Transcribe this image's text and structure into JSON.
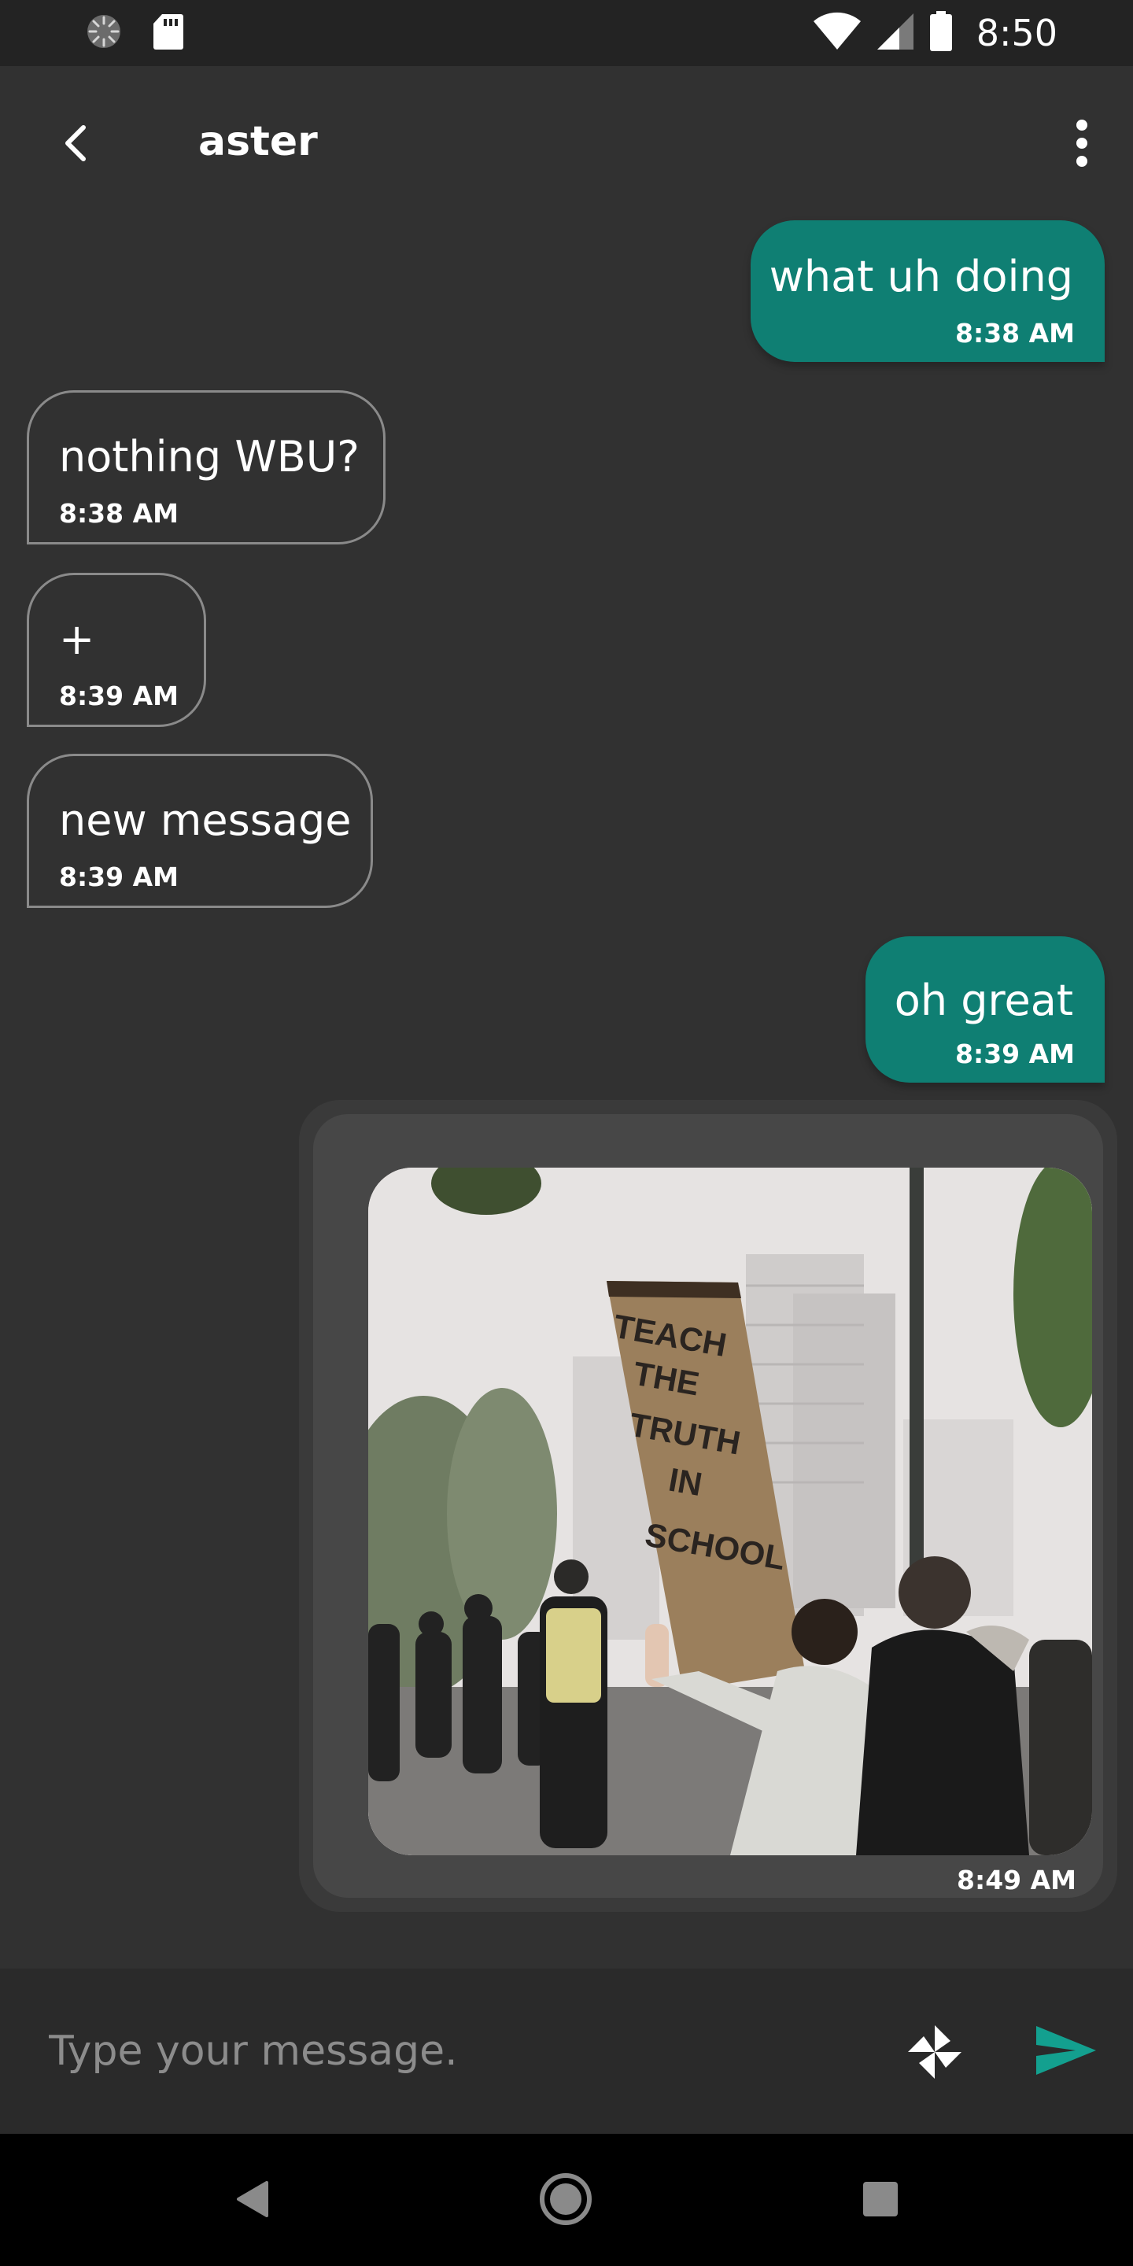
{
  "status_bar": {
    "time": "8:50",
    "icons": [
      "sync-icon",
      "sd-card-icon",
      "wifi-icon",
      "cell-signal-icon",
      "battery-icon"
    ]
  },
  "header": {
    "title": "aster",
    "back_icon": "chevron-left-icon",
    "menu_icon": "more-vertical-icon"
  },
  "messages": [
    {
      "direction": "out",
      "text": "what uh doing",
      "time": "8:38 AM"
    },
    {
      "direction": "in",
      "text": "nothing WBU?",
      "time": "8:38 AM"
    },
    {
      "direction": "in",
      "text": "+",
      "time": "8:39 AM"
    },
    {
      "direction": "in",
      "text": "new message",
      "time": "8:39 AM"
    },
    {
      "direction": "out",
      "text": "oh great",
      "time": "8:39 AM"
    },
    {
      "direction": "out",
      "type": "image",
      "sign_text": "TEACH THE TRUTH IN SCHOOL",
      "time": "8:49 AM"
    }
  ],
  "composer": {
    "placeholder": "Type your message.",
    "attach_icon": "pinwheel-icon",
    "send_icon": "send-icon"
  },
  "nav": {
    "icons": [
      "nav-back-icon",
      "nav-home-icon",
      "nav-recents-icon"
    ]
  },
  "colors": {
    "background": "#313131",
    "status_bar": "#232323",
    "outgoing_bubble": "#0f7f73",
    "incoming_border": "#8a8a8a",
    "accent": "#13a08f",
    "composer_bg": "#2a2a2a"
  }
}
